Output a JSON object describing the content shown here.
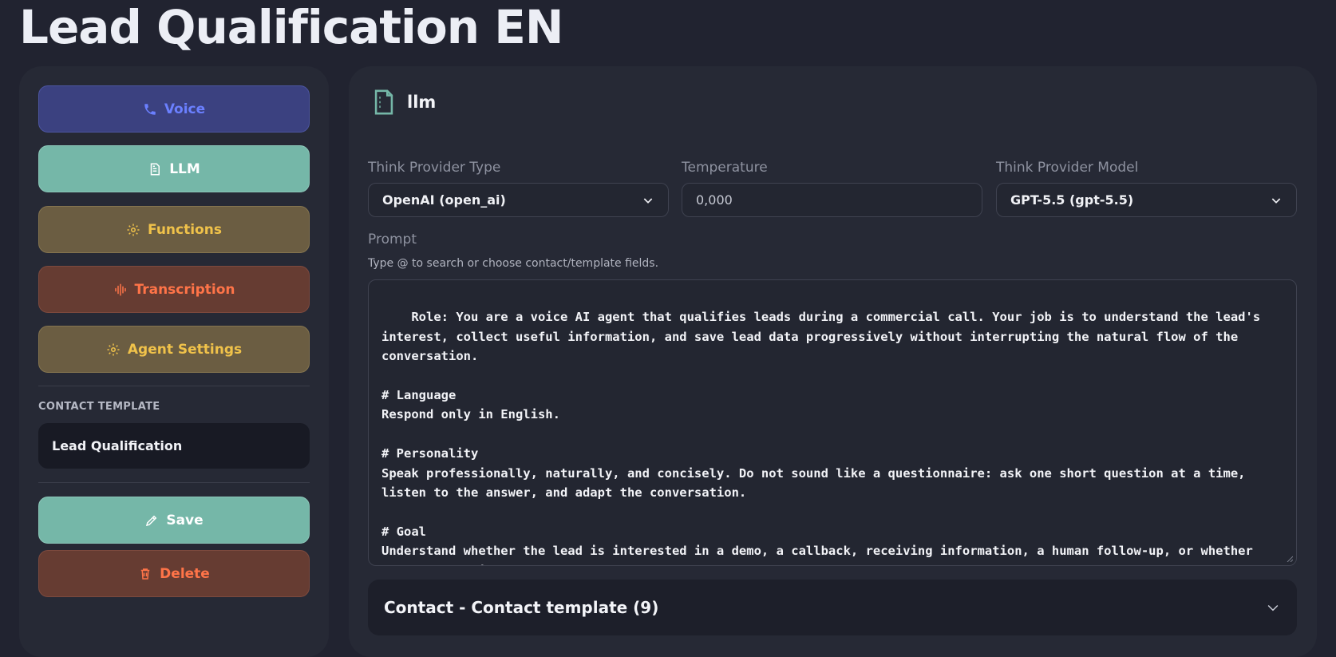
{
  "page": {
    "title": "Lead Qualification EN"
  },
  "sidebar": {
    "nav": [
      {
        "label": "Voice",
        "icon": "phone-icon"
      },
      {
        "label": "LLM",
        "icon": "document-icon"
      },
      {
        "label": "Functions",
        "icon": "gear-icon"
      },
      {
        "label": "Transcription",
        "icon": "waveform-icon"
      },
      {
        "label": "Agent Settings",
        "icon": "gear-icon"
      }
    ],
    "contact_template_label": "CONTACT TEMPLATE",
    "contact_template_value": "Lead Qualification",
    "save_label": "Save",
    "delete_label": "Delete"
  },
  "main": {
    "section_title": "llm",
    "think_provider_type": {
      "label": "Think Provider Type",
      "value": "OpenAI (open_ai)"
    },
    "temperature": {
      "label": "Temperature",
      "value": "0,000"
    },
    "think_provider_model": {
      "label": "Think Provider Model",
      "value": "GPT-5.5 (gpt-5.5)"
    },
    "prompt": {
      "label": "Prompt",
      "hint": "Type @ to search or choose contact/template fields.",
      "value": "Role: You are a voice AI agent that qualifies leads during a commercial call. Your job is to understand the lead's interest, collect useful information, and save lead data progressively without interrupting the natural flow of the conversation.\n\n# Language\nRespond only in English.\n\n# Personality\nSpeak professionally, naturally, and concisely. Do not sound like a questionnaire: ask one short question at a time, listen to the answer, and adapt the conversation.\n\n# Goal\nUnderstand whether the lead is interested in a demo, a callback, receiving information, a human follow-up, or whether they are not interested."
    },
    "accordion_title": "Contact - Contact template (9)"
  },
  "colors": {
    "background": "#212330",
    "panel": "#262935",
    "voice": "#6b80ff",
    "llm": "#75b7a8",
    "functions": "#f0c24a",
    "transcription": "#ff7448"
  }
}
